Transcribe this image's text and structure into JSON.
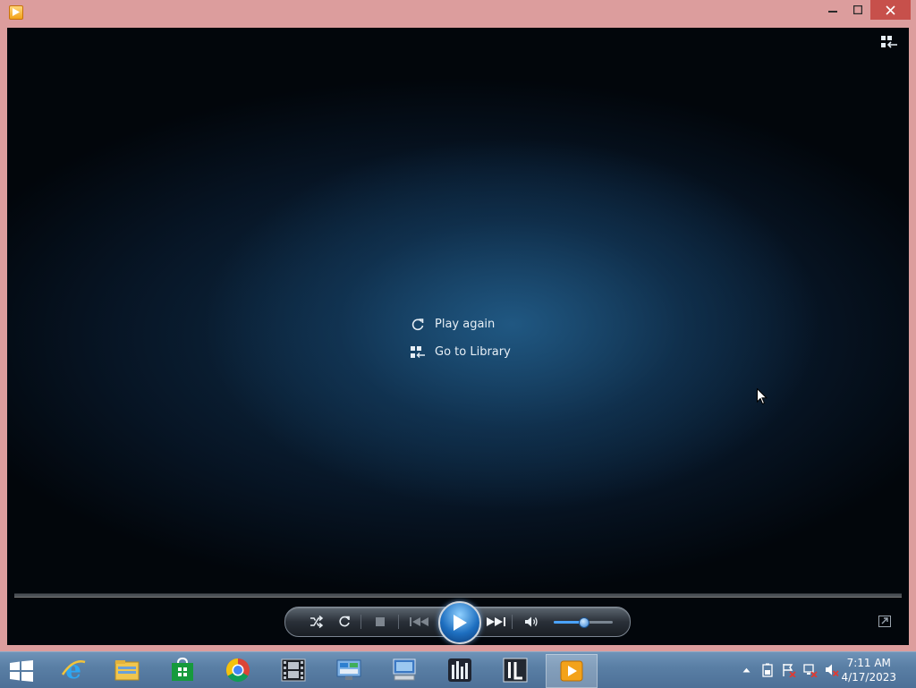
{
  "window": {
    "title_icon": "windows-media-player-icon",
    "controls": {
      "minimize": "minimize-icon",
      "maximize": "maximize-icon",
      "close": "close-icon"
    },
    "frame_color": "#dc9d9d"
  },
  "now_playing": {
    "switch_icon": "switch-to-library-icon",
    "menu": [
      {
        "label": "Play again",
        "icon": "refresh-icon"
      },
      {
        "label": "Go to Library",
        "icon": "library-grid-icon"
      }
    ]
  },
  "player_controls": {
    "buttons": [
      "shuffle",
      "repeat",
      "stop",
      "previous",
      "play",
      "next",
      "mute"
    ],
    "volume_level": 0.5,
    "accent_color": "#2f7fd4",
    "fullscreen_icon": "fullscreen-toggle-icon"
  },
  "taskbar": {
    "start_icon": "windows-start-icon",
    "pinned_apps": [
      {
        "name": "Internet Explorer",
        "icon": "ie-icon"
      },
      {
        "name": "File Explorer",
        "icon": "folder-icon"
      },
      {
        "name": "Store",
        "icon": "store-icon"
      },
      {
        "name": "Chrome",
        "icon": "chrome-icon"
      },
      {
        "name": "Movie Maker",
        "icon": "film-icon"
      },
      {
        "name": "Control Panel",
        "icon": "control-panel-icon"
      },
      {
        "name": "Remote Desktop",
        "icon": "computer-icon"
      },
      {
        "name": "Equalizer App",
        "icon": "equalizer-icon"
      },
      {
        "name": "App",
        "icon": "app-l-icon"
      },
      {
        "name": "Windows Media Player",
        "icon": "media-player-icon",
        "active": true
      }
    ],
    "tray_icons": [
      "show-hidden-icons-icon",
      "battery-icon",
      "action-center-icon",
      "network-icon",
      "volume-muted-icon"
    ],
    "clock": {
      "time": "7:11 AM",
      "date": "4/17/2023"
    }
  }
}
